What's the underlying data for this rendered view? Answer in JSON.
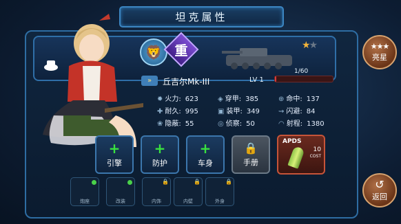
{
  "title": "坦克属性",
  "star_button": {
    "stars": "★★★",
    "label": "亮星"
  },
  "back_button": {
    "arrow": "↺",
    "label": "返回"
  },
  "tank": {
    "class_label": "重",
    "name": "丘吉尔Mk-III",
    "rank_stars": {
      "filled": "★",
      "empty": "★"
    },
    "level": "LV 1",
    "xp": "1/60",
    "xp_fraction": 0.0167
  },
  "stats": {
    "firepower": {
      "label": "火力:",
      "value": "623"
    },
    "penetration": {
      "label": "穿甲:",
      "value": "385"
    },
    "accuracy": {
      "label": "命中:",
      "value": "137"
    },
    "durability": {
      "label": "耐久:",
      "value": "995"
    },
    "armor": {
      "label": "装甲:",
      "value": "349"
    },
    "evasion": {
      "label": "闪避:",
      "value": "84"
    },
    "concealment": {
      "label": "隐蔽:",
      "value": "55"
    },
    "spotting": {
      "label": "侦察:",
      "value": "50"
    },
    "range": {
      "label": "射程:",
      "value": "1380"
    }
  },
  "upgrade_tiles": [
    {
      "label": "引擎"
    },
    {
      "label": "防护"
    },
    {
      "label": "车身"
    },
    {
      "label": "手册"
    }
  ],
  "ammo": {
    "name": "APDS",
    "cost_value": "10",
    "cost_label": "COST"
  },
  "slots": [
    {
      "label": "炮座"
    },
    {
      "label": "改装"
    },
    {
      "label": "内饰"
    },
    {
      "label": "内壁"
    },
    {
      "label": "外身"
    }
  ],
  "colors": {
    "accent": "#2f6fa8",
    "plus_green": "#39e23f",
    "ammo_red": "#c75439",
    "button_bronze": "#6b3518"
  }
}
